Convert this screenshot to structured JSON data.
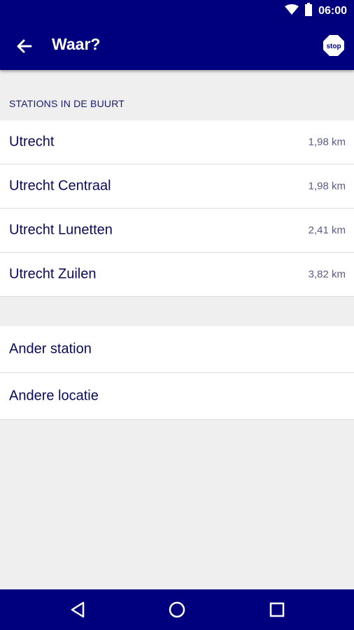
{
  "status_bar": {
    "time": "06:00"
  },
  "app_bar": {
    "title": "Waar?",
    "stop_label": "stop"
  },
  "nearby": {
    "header": "STATIONS IN DE BUURT",
    "stations": [
      {
        "name": "Utrecht",
        "distance": "1,98 km"
      },
      {
        "name": "Utrecht Centraal",
        "distance": "1,98 km"
      },
      {
        "name": "Utrecht Lunetten",
        "distance": "2,41 km"
      },
      {
        "name": "Utrecht Zuilen",
        "distance": "3,82 km"
      }
    ]
  },
  "other_options": [
    {
      "label": "Ander station"
    },
    {
      "label": "Andere locatie"
    }
  ],
  "colors": {
    "primary": "#00007f",
    "background": "#efefef",
    "text": "#0a0a5a"
  },
  "icons": [
    "wifi-icon",
    "battery-icon",
    "back-arrow-icon",
    "stop-icon",
    "nav-back-icon",
    "nav-home-icon",
    "nav-recents-icon"
  ]
}
